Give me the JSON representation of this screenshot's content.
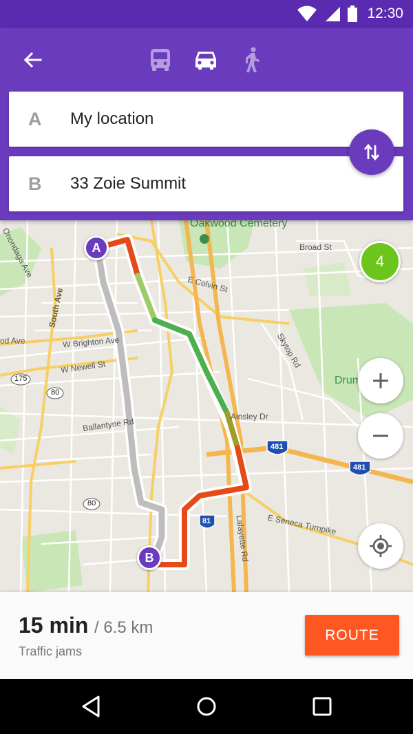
{
  "status_bar": {
    "time": "12:30"
  },
  "toolbar": {
    "modes": [
      {
        "id": "bus",
        "icon": "bus-icon"
      },
      {
        "id": "car",
        "icon": "car-icon",
        "selected": true
      },
      {
        "id": "walk",
        "icon": "walk-icon"
      }
    ]
  },
  "route_fields": {
    "from": {
      "letter": "A",
      "value": "My location"
    },
    "to": {
      "letter": "B",
      "value": "33 Zoie Summit"
    }
  },
  "map": {
    "markers": {
      "start": "A",
      "end": "B"
    },
    "cluster_count": "4",
    "labels": {
      "cemetery": "Oakwood Cemetery",
      "broad_st": "Broad St",
      "colvin": "E Colvin St",
      "brighton": "W Brighton Ave",
      "newell": "W Newell St",
      "ballantyne": "Ballantyne Rd",
      "ainsley": "Ainsley Dr",
      "seneca": "E Seneca Turnpike",
      "lafayette": "Lafayette Rd",
      "south_ave": "South Ave",
      "onondaga": "Onondaga Ave",
      "skytop": "Skytop Rd",
      "drumlins": "Drumlins",
      "wood_ave": "od Ave",
      "route_175": "175",
      "route_80a": "80",
      "route_80b": "80",
      "route_481a": "481",
      "route_481b": "481",
      "route_81": "81"
    },
    "traffic_colors": {
      "jam": "#e64a19",
      "slow": "#f9a825",
      "free": "#4caf50",
      "alt_route": "#bdbdbd"
    }
  },
  "summary": {
    "duration": "15 min",
    "distance": "/ 6.5 km",
    "traffic": "Traffic jams",
    "route_button": "ROUTE"
  },
  "colors": {
    "primary": "#6a3bbd",
    "accent": "#ff5722"
  }
}
